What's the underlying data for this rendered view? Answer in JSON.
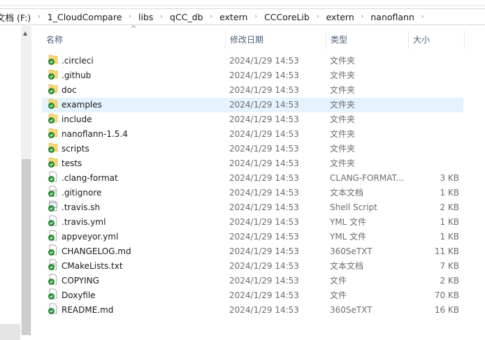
{
  "breadcrumb": [
    "文档 (F:)",
    "1_CloudCompare",
    "libs",
    "qCC_db",
    "extern",
    "CCCoreLib",
    "extern",
    "nanoflann"
  ],
  "columns": {
    "name": "名称",
    "date": "修改日期",
    "type": "类型",
    "size": "大小"
  },
  "selected_index": 3,
  "files": [
    {
      "name": ".circleci",
      "date": "2024/1/29 14:53",
      "type": "文件夹",
      "size": "",
      "kind": "folder"
    },
    {
      "name": ".github",
      "date": "2024/1/29 14:53",
      "type": "文件夹",
      "size": "",
      "kind": "folder"
    },
    {
      "name": "doc",
      "date": "2024/1/29 14:53",
      "type": "文件夹",
      "size": "",
      "kind": "folder"
    },
    {
      "name": "examples",
      "date": "2024/1/29 14:53",
      "type": "文件夹",
      "size": "",
      "kind": "folder"
    },
    {
      "name": "include",
      "date": "2024/1/29 14:53",
      "type": "文件夹",
      "size": "",
      "kind": "folder"
    },
    {
      "name": "nanoflann-1.5.4",
      "date": "2024/1/29 14:53",
      "type": "文件夹",
      "size": "",
      "kind": "folder"
    },
    {
      "name": "scripts",
      "date": "2024/1/29 14:53",
      "type": "文件夹",
      "size": "",
      "kind": "folder"
    },
    {
      "name": "tests",
      "date": "2024/1/29 14:53",
      "type": "文件夹",
      "size": "",
      "kind": "folder"
    },
    {
      "name": ".clang-format",
      "date": "2024/1/29 14:53",
      "type": "CLANG-FORMAT...",
      "size": "3 KB",
      "kind": "file"
    },
    {
      "name": ".gitignore",
      "date": "2024/1/29 14:53",
      "type": "文本文档",
      "size": "1 KB",
      "kind": "text"
    },
    {
      "name": ".travis.sh",
      "date": "2024/1/29 14:53",
      "type": "Shell Script",
      "size": "2 KB",
      "kind": "script"
    },
    {
      "name": ".travis.yml",
      "date": "2024/1/29 14:53",
      "type": "YML 文件",
      "size": "1 KB",
      "kind": "file"
    },
    {
      "name": "appveyor.yml",
      "date": "2024/1/29 14:53",
      "type": "YML 文件",
      "size": "1 KB",
      "kind": "file"
    },
    {
      "name": "CHANGELOG.md",
      "date": "2024/1/29 14:53",
      "type": "360SeTXT",
      "size": "11 KB",
      "kind": "file"
    },
    {
      "name": "CMakeLists.txt",
      "date": "2024/1/29 14:53",
      "type": "文本文档",
      "size": "7 KB",
      "kind": "text"
    },
    {
      "name": "COPYING",
      "date": "2024/1/29 14:53",
      "type": "文件",
      "size": "2 KB",
      "kind": "file"
    },
    {
      "name": "Doxyfile",
      "date": "2024/1/29 14:53",
      "type": "文件",
      "size": "70 KB",
      "kind": "file"
    },
    {
      "name": "README.md",
      "date": "2024/1/29 14:53",
      "type": "360SeTXT",
      "size": "16 KB",
      "kind": "file"
    }
  ]
}
